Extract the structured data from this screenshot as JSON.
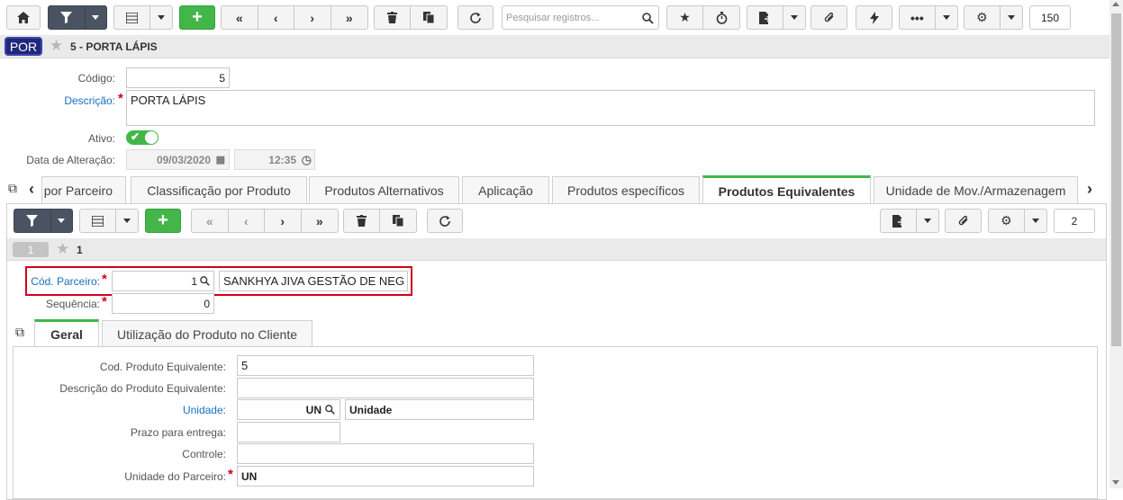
{
  "toolbar": {
    "search_placeholder": "Pesquisar registros...",
    "count": "150"
  },
  "header": {
    "badge": "POR",
    "title": "5 - PORTA LÁPIS"
  },
  "form": {
    "codigo_label": "Código:",
    "codigo_value": "5",
    "descricao_label": "Descrição:",
    "descricao_value": "PORTA LÁPIS",
    "ativo_label": "Ativo:",
    "data_alteracao_label": "Data de Alteração:",
    "data_value": "09/03/2020",
    "hora_value": "12:35"
  },
  "tabs": [
    {
      "label": "por Parceiro"
    },
    {
      "label": "Classificação por Produto"
    },
    {
      "label": "Produtos Alternativos"
    },
    {
      "label": "Aplicação"
    },
    {
      "label": "Produtos específicos"
    },
    {
      "label": "Produtos Equivalentes"
    },
    {
      "label": "Unidade de Mov./Armazenagem"
    }
  ],
  "subtoolbar": {
    "count": "2"
  },
  "record": {
    "badge": "1",
    "title": "1"
  },
  "detail": {
    "cod_parceiro_label": "Cód. Parceiro:",
    "cod_parceiro_value": "1",
    "parceiro_nome": "SANKHYA JIVA GESTÃO DE NEG",
    "sequencia_label": "Sequência:",
    "sequencia_value": "0"
  },
  "inner_tabs": [
    {
      "label": "Geral"
    },
    {
      "label": "Utilização do Produto no Cliente"
    }
  ],
  "geral": {
    "cod_prod_equiv_label": "Cod. Produto Equivalente:",
    "cod_prod_equiv_value": "5",
    "desc_prod_equiv_label": "Descrição do Produto Equivalente:",
    "desc_prod_equiv_value": "",
    "unidade_label": "Unidade:",
    "unidade_value": "UN",
    "unidade_desc": "Unidade",
    "prazo_label": "Prazo para entrega:",
    "controle_label": "Controle:",
    "unidade_parceiro_label": "Unidade do Parceiro:",
    "unidade_parceiro_value": "UN"
  },
  "colors": {
    "accent_green": "#43b649",
    "dark_button": "#4a5361",
    "link_blue": "#1a6fc4",
    "required_red": "#d0021b",
    "highlight_red": "#d0021b"
  }
}
